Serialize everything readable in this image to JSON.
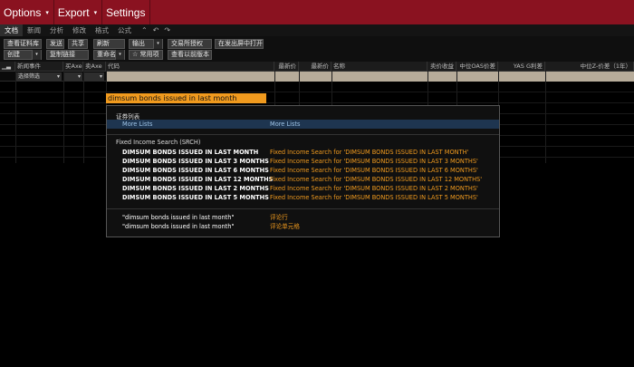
{
  "menu": [
    {
      "label": "Options",
      "caret": "▾"
    },
    {
      "label": "Export",
      "caret": "▾"
    },
    {
      "label": "Settings",
      "caret": ""
    }
  ],
  "tabs": [
    "文档",
    "新闻",
    "分析",
    "修改",
    "格式",
    "公式"
  ],
  "tab_icons": [
    "collapse-icon",
    "undo-icon",
    "redo-icon"
  ],
  "toolbar": {
    "view_securities": "查看证料库",
    "send": "发送",
    "share": "共享",
    "refresh": "刷新",
    "output": "输出",
    "exchange_auth": "交易所授权",
    "open_new_screen": "在发出屏中打开",
    "create": "创建",
    "copy_link": "复制链接",
    "rename": "重命名",
    "favorites": "☆ 常用项",
    "view_previous": "查看以前版本"
  },
  "columns": [
    "新闻事件",
    "买Axe",
    "卖Axe",
    "代码",
    "最新价",
    "最新价",
    "名称",
    "卖价收益",
    "中位OAS价差",
    "YAS G利差",
    "中位Z-价差（1年）"
  ],
  "filter": {
    "label": "选择筛选"
  },
  "search": {
    "value": "dimsum bonds issued in last month"
  },
  "popup": {
    "section_lists": "证券列表",
    "more_lists_left": "More Lists",
    "more_lists_right": "More Lists",
    "section_srch": "Fixed Income Search (SRCH)",
    "srch_items": [
      {
        "left": "DIMSUM BONDS ISSUED IN LAST MONTH",
        "right": "Fixed Income Search for 'DIMSUM BONDS ISSUED IN LAST MONTH'"
      },
      {
        "left": "DIMSUM BONDS ISSUED IN LAST 3 MONTHS",
        "right": "Fixed Income Search for 'DIMSUM BONDS ISSUED IN LAST 3 MONTHS'"
      },
      {
        "left": "DIMSUM BONDS ISSUED IN LAST 6 MONTHS",
        "right": "Fixed Income Search for 'DIMSUM BONDS ISSUED IN LAST 6 MONTHS'"
      },
      {
        "left": "DIMSUM BONDS ISSUED IN LAST 12 MONTHS",
        "right": "Fixed Income Search for 'DIMSUM BONDS ISSUED IN LAST 12 MONTHS'"
      },
      {
        "left": "DIMSUM BONDS ISSUED IN LAST 2 MONTHS",
        "right": "Fixed Income Search for 'DIMSUM BONDS ISSUED IN LAST 2 MONTHS'"
      },
      {
        "left": "DIMSUM BONDS ISSUED IN LAST 5 MONTHS",
        "right": "Fixed Income Search for 'DIMSUM BONDS ISSUED IN LAST 5 MONTHS'"
      }
    ],
    "comment_items": [
      {
        "left": "\"dimsum bonds issued in last month\"",
        "right": "评论行"
      },
      {
        "left": "\"dimsum bonds issued in last month\"",
        "right": "评论单元格"
      }
    ]
  }
}
